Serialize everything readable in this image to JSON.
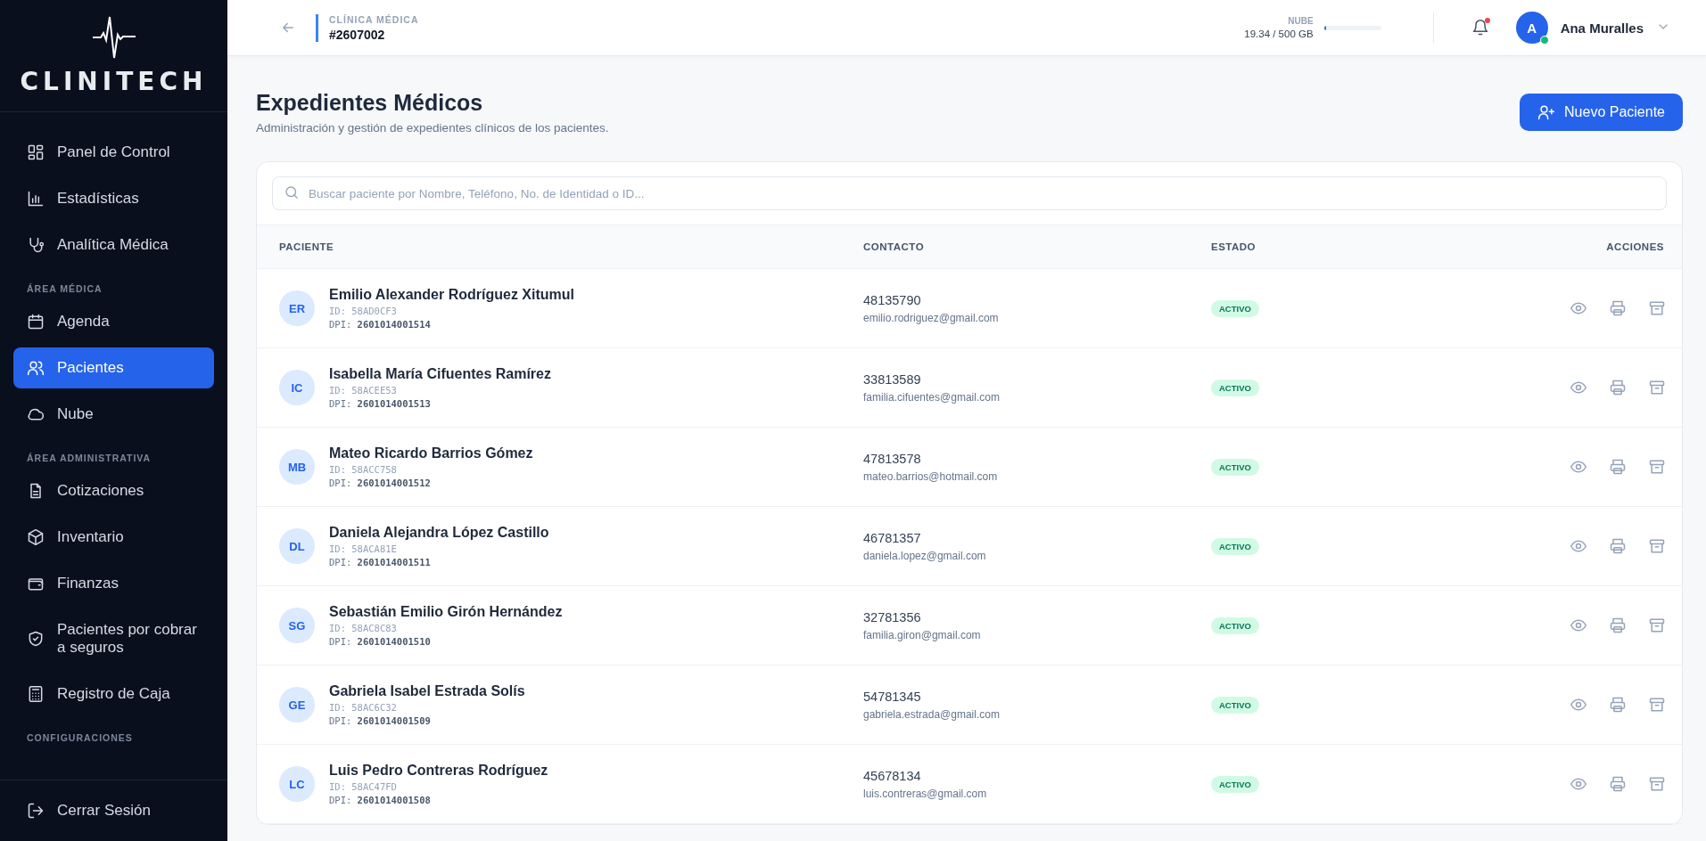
{
  "sidebar": {
    "logo": "CLINITECH",
    "sections": [
      {
        "items": [
          {
            "label": "Panel de Control",
            "selected": false
          },
          {
            "label": "Estadísticas",
            "selected": false
          },
          {
            "label": "Analítica Médica",
            "selected": false
          }
        ]
      },
      {
        "heading": "ÁREA MÉDICA",
        "items": [
          {
            "label": "Agenda",
            "selected": false
          },
          {
            "label": "Pacientes",
            "selected": true
          },
          {
            "label": "Nube",
            "selected": false
          }
        ]
      },
      {
        "heading": "ÁREA ADMINISTRATIVA",
        "items": [
          {
            "label": "Cotizaciones",
            "selected": false
          },
          {
            "label": "Inventario",
            "selected": false
          },
          {
            "label": "Finanzas",
            "selected": false
          },
          {
            "label": "Pacientes por cobrar a seguros",
            "selected": false
          },
          {
            "label": "Registro de Caja",
            "selected": false
          }
        ]
      },
      {
        "heading": "CONFIGURACIONES"
      }
    ],
    "logout": "Cerrar Sesión"
  },
  "header": {
    "clinic_label": "CLÍNICA MÉDICA",
    "clinic_id": "#2607002",
    "storage": {
      "label": "NUBE",
      "reading": "19.34 / 500 GB",
      "level": 0.04
    },
    "notifications": {
      "unread": true
    },
    "user": {
      "initial": "A",
      "name": "Ana Muralles",
      "online": true
    }
  },
  "page": {
    "title": "Expedientes Médicos",
    "subtitle": "Administración y gestión de expedientes clínicos de los pacientes.",
    "new_button": "Nuevo Paciente"
  },
  "search": {
    "placeholder": "Buscar paciente por Nombre, Teléfono, No. de Identidad o ID..."
  },
  "table": {
    "columns": [
      "PACIENTE",
      "CONTACTO",
      "ESTADO",
      "ACCIONES"
    ],
    "rows": [
      {
        "initials": "ER",
        "name": "Emilio Alexander Rodríguez Xitumul",
        "id": "ID: 58AD0CF3",
        "dpi": "DPI: **2601014001514**",
        "phone": "48135790",
        "email": "emilio.rodriguez@gmail.com",
        "status": "ACTIVO"
      },
      {
        "initials": "IC",
        "name": "Isabella María Cifuentes Ramírez",
        "id": "ID: 58ACEE53",
        "dpi": "DPI: **2601014001513**",
        "phone": "33813589",
        "email": "familia.cifuentes@gmail.com",
        "status": "ACTIVO"
      },
      {
        "initials": "MB",
        "name": "Mateo Ricardo Barrios Gómez",
        "id": "ID: 58ACC758",
        "dpi": "DPI: **2601014001512**",
        "phone": "47813578",
        "email": "mateo.barrios@hotmail.com",
        "status": "ACTIVO"
      },
      {
        "initials": "DL",
        "name": "Daniela Alejandra López Castillo",
        "id": "ID: 58ACA81E",
        "dpi": "DPI: **2601014001511**",
        "phone": "46781357",
        "email": "daniela.lopez@gmail.com",
        "status": "ACTIVO"
      },
      {
        "initials": "SG",
        "name": "Sebastián Emilio Girón Hernández",
        "id": "ID: 58AC8C83",
        "dpi": "DPI: **2601014001510**",
        "phone": "32781356",
        "email": "familia.giron@gmail.com",
        "status": "ACTIVO"
      },
      {
        "initials": "GE",
        "name": "Gabriela Isabel Estrada Solís",
        "id": "ID: 58AC6C32",
        "dpi": "DPI: **2601014001509**",
        "phone": "54781345",
        "email": "gabriela.estrada@gmail.com",
        "status": "ACTIVO"
      },
      {
        "initials": "LC",
        "name": "Luis Pedro Contreras Rodríguez",
        "id": "ID: 58AC47FD",
        "dpi": "DPI: **2601014001508**",
        "phone": "45678134",
        "email": "luis.contreras@gmail.com",
        "status": "ACTIVO"
      }
    ]
  }
}
